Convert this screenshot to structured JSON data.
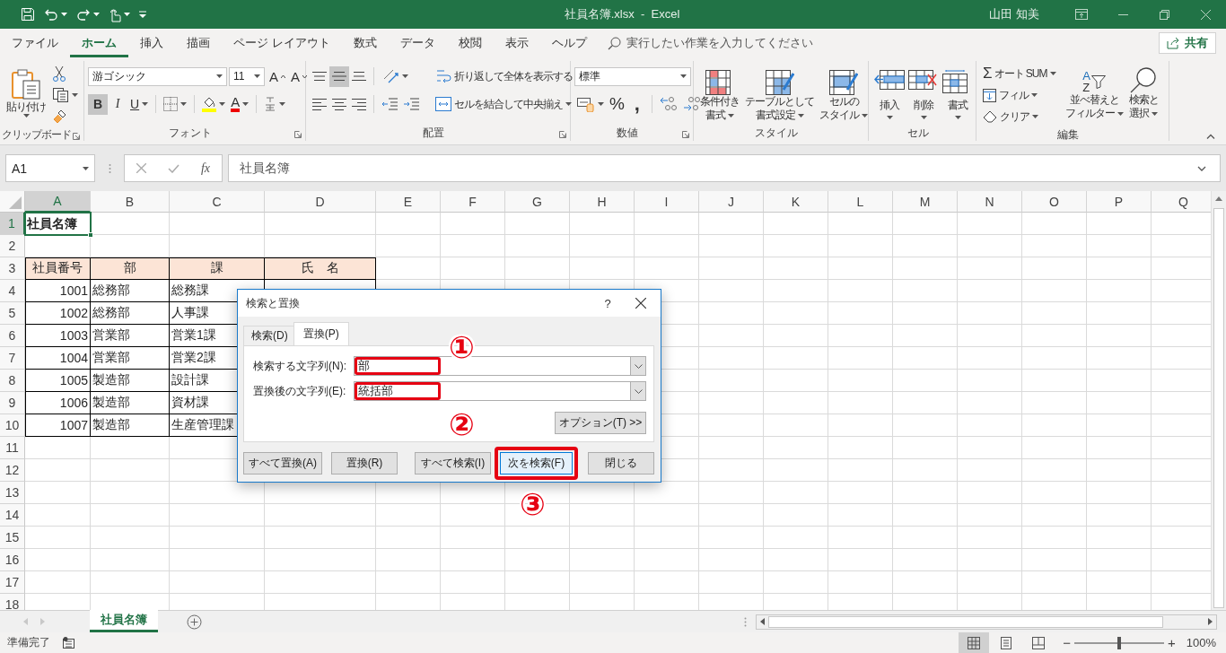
{
  "title_bar": {
    "title": "社員名簿.xlsx  -  Excel",
    "user": "山田 知美"
  },
  "menu_tabs": [
    {
      "label": "ファイル",
      "selected": false
    },
    {
      "label": "ホーム",
      "selected": true
    },
    {
      "label": "挿入",
      "selected": false
    },
    {
      "label": "描画",
      "selected": false
    },
    {
      "label": "ページ レイアウト",
      "selected": false
    },
    {
      "label": "数式",
      "selected": false
    },
    {
      "label": "データ",
      "selected": false
    },
    {
      "label": "校閲",
      "selected": false
    },
    {
      "label": "表示",
      "selected": false
    },
    {
      "label": "ヘルプ",
      "selected": false
    }
  ],
  "tell_me": {
    "placeholder": "実行したい作業を入力してください"
  },
  "share_button": {
    "label": "共有"
  },
  "ribbon": {
    "clipboard": {
      "label": "クリップボード",
      "paste": "貼り付け"
    },
    "font": {
      "label": "フォント",
      "font_name": "游ゴシック",
      "font_size": "11",
      "grow": "A",
      "shrink": "A",
      "bold": {
        "glyph": "B",
        "on": true
      },
      "italic": {
        "glyph": "I",
        "on": false
      },
      "underline": {
        "glyph": "U",
        "on": false
      },
      "font_color": "A"
    },
    "alignment": {
      "label": "配置",
      "vertical_align": [
        {
          "kind": "top",
          "selected": false
        },
        {
          "kind": "middle",
          "selected": true
        },
        {
          "kind": "bottom",
          "selected": false
        }
      ],
      "wrap_text": "折り返して全体を表示する",
      "merge": "セルを結合して中央揃え"
    },
    "number": {
      "label": "数値",
      "format": "標準",
      "percent": "%",
      "comma": ","
    },
    "styles": {
      "label": "スタイル",
      "buttons": [
        {
          "kind": "conditional",
          "lines": [
            "条件付き",
            "書式"
          ]
        },
        {
          "kind": "table",
          "lines": [
            "テーブルとして",
            "書式設定"
          ]
        },
        {
          "kind": "cell",
          "lines": [
            "セルの",
            "スタイル"
          ]
        }
      ]
    },
    "cells": {
      "label": "セル",
      "buttons": [
        {
          "kind": "insert",
          "label": "挿入"
        },
        {
          "kind": "delete",
          "label": "削除"
        },
        {
          "kind": "format",
          "label": "書式"
        }
      ]
    },
    "editing": {
      "label": "編集",
      "autosum": {
        "glyph": "Σ",
        "label": "オート SUM"
      },
      "fill": "フィル",
      "clear": "クリア",
      "sort": {
        "glyphs": [
          "A",
          "Z"
        ],
        "lines": [
          "並べ替えと",
          "フィルター"
        ]
      },
      "find": {
        "lines": [
          "検索と",
          "選択"
        ]
      }
    }
  },
  "formula_bar": {
    "name_box": "A1",
    "fx": "fx",
    "formula": "社員名簿"
  },
  "sheet": {
    "columns": [
      {
        "label": "A",
        "selected": true
      },
      {
        "label": "B",
        "selected": false
      },
      {
        "label": "C",
        "selected": false
      },
      {
        "label": "D",
        "selected": false
      },
      {
        "label": "E",
        "selected": false
      },
      {
        "label": "F",
        "selected": false
      },
      {
        "label": "G",
        "selected": false
      },
      {
        "label": "H",
        "selected": false
      },
      {
        "label": "I",
        "selected": false
      },
      {
        "label": "J",
        "selected": false
      },
      {
        "label": "K",
        "selected": false
      },
      {
        "label": "L",
        "selected": false
      },
      {
        "label": "M",
        "selected": false
      },
      {
        "label": "N",
        "selected": false
      },
      {
        "label": "O",
        "selected": false
      },
      {
        "label": "P",
        "selected": false
      },
      {
        "label": "Q",
        "selected": false
      }
    ],
    "rows": [
      {
        "number": "1",
        "selected": true,
        "cells": [
          {
            "kind": "title",
            "text": "社員名簿"
          }
        ]
      },
      {
        "number": "2",
        "selected": false
      },
      {
        "number": "3",
        "selected": false,
        "cells": [
          {
            "kind": "header",
            "text": "社員番号"
          },
          {
            "kind": "header",
            "text": "部"
          },
          {
            "kind": "header",
            "text": "課"
          },
          {
            "kind": "header",
            "text": "氏　名"
          }
        ]
      },
      {
        "number": "4",
        "selected": false,
        "cells": [
          {
            "kind": "number",
            "text": "1001"
          },
          {
            "kind": "text",
            "text": "総務部"
          },
          {
            "kind": "text",
            "text": "総務課"
          },
          {
            "kind": "blank"
          }
        ]
      },
      {
        "number": "5",
        "selected": false,
        "cells": [
          {
            "kind": "number",
            "text": "1002"
          },
          {
            "kind": "text",
            "text": "総務部"
          },
          {
            "kind": "text",
            "text": "人事課"
          }
        ]
      },
      {
        "number": "6",
        "selected": false,
        "cells": [
          {
            "kind": "number",
            "text": "1003"
          },
          {
            "kind": "text",
            "text": "営業部"
          },
          {
            "kind": "text",
            "text": "営業1課"
          }
        ]
      },
      {
        "number": "7",
        "selected": false,
        "cells": [
          {
            "kind": "number",
            "text": "1004"
          },
          {
            "kind": "text",
            "text": "営業部"
          },
          {
            "kind": "text",
            "text": "営業2課"
          }
        ]
      },
      {
        "number": "8",
        "selected": false,
        "cells": [
          {
            "kind": "number",
            "text": "1005"
          },
          {
            "kind": "text",
            "text": "製造部"
          },
          {
            "kind": "text",
            "text": "設計課"
          }
        ]
      },
      {
        "number": "9",
        "selected": false,
        "cells": [
          {
            "kind": "number",
            "text": "1006"
          },
          {
            "kind": "text",
            "text": "製造部"
          },
          {
            "kind": "text",
            "text": "資材課"
          }
        ]
      },
      {
        "number": "10",
        "selected": false,
        "cells": [
          {
            "kind": "number",
            "text": "1007"
          },
          {
            "kind": "text",
            "text": "製造部"
          },
          {
            "kind": "text",
            "text": "生産管理課"
          }
        ]
      },
      {
        "number": "11",
        "selected": false
      },
      {
        "number": "12",
        "selected": false
      },
      {
        "number": "13",
        "selected": false
      },
      {
        "number": "14",
        "selected": false
      },
      {
        "number": "15",
        "selected": false
      },
      {
        "number": "16",
        "selected": false
      },
      {
        "number": "17",
        "selected": false
      },
      {
        "number": "18",
        "selected": false
      }
    ]
  },
  "sheet_tabs": [
    {
      "label": "社員名簿",
      "selected": true
    }
  ],
  "status_bar": {
    "status": "準備完了",
    "views": [
      {
        "kind": "normal",
        "selected": true
      },
      {
        "kind": "page_layout",
        "selected": false
      },
      {
        "kind": "page_break",
        "selected": false
      }
    ],
    "zoom_out": "−",
    "zoom_slider": {
      "level": 0.5
    },
    "zoom_in": "+",
    "zoom": "100%"
  },
  "dialog": {
    "title": "検索と置換",
    "help": "?",
    "tabs": [
      {
        "label": "検索(D)",
        "selected": false
      },
      {
        "label": "置換(P)",
        "selected": true
      }
    ],
    "fields": [
      {
        "label": "検索する文字列(N):",
        "value": "部",
        "marked": true,
        "callout": "①"
      },
      {
        "label": "置換後の文字列(E):",
        "value": "統括部",
        "marked": true,
        "callout": "②"
      }
    ],
    "options_button": "オプション(T) >>",
    "buttons": [
      {
        "label": "すべて置換(A)",
        "highlighted": false,
        "marked": false
      },
      {
        "label": "置換(R)",
        "highlighted": false,
        "marked": false
      },
      {
        "label": "すべて検索(I)",
        "highlighted": false,
        "marked": false
      },
      {
        "label": "次を検索(F)",
        "highlighted": true,
        "marked": true,
        "callout": "③"
      },
      {
        "label": "閉じる",
        "highlighted": false,
        "marked": false
      }
    ]
  }
}
